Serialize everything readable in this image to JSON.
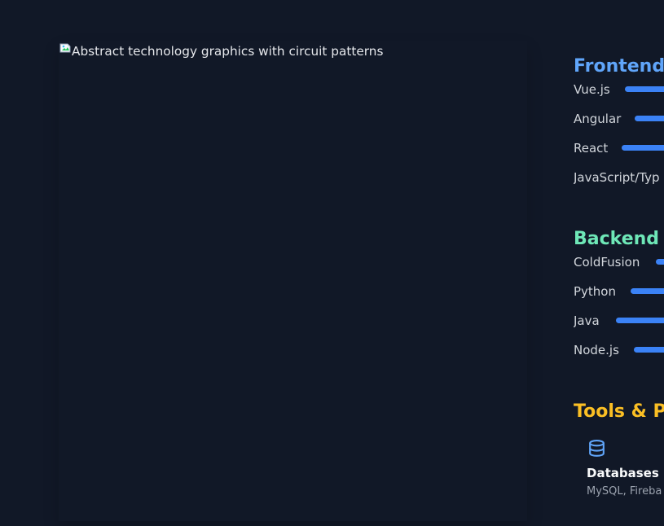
{
  "hero_image": {
    "alt": "Abstract technology graphics with circuit patterns",
    "icon": "broken-image-icon"
  },
  "sections": {
    "frontend": {
      "title": "Frontend",
      "color": "#60a5fa",
      "skills": [
        {
          "name": "Vue.js",
          "level_visible": "true"
        },
        {
          "name": "Angular",
          "level_visible": "true"
        },
        {
          "name": "React",
          "level_visible": "true"
        },
        {
          "name": "JavaScript/Typ",
          "level_visible": "false"
        }
      ]
    },
    "backend": {
      "title": "Backend T",
      "color": "#6ee7b7",
      "skills": [
        {
          "name": "ColdFusion",
          "level_visible": "true"
        },
        {
          "name": "Python",
          "level_visible": "true"
        },
        {
          "name": "Java",
          "level_visible": "true"
        },
        {
          "name": "Node.js",
          "level_visible": "true"
        }
      ]
    },
    "tools": {
      "title": "Tools & Pl",
      "color": "#fbbf24",
      "items": [
        {
          "title": "Databases",
          "description": "MySQL, Fireba",
          "icon": "database-icon"
        }
      ]
    }
  },
  "colors": {
    "background": "#111827",
    "skill_bar": "#3b82f6",
    "text": "#d1d5db"
  }
}
